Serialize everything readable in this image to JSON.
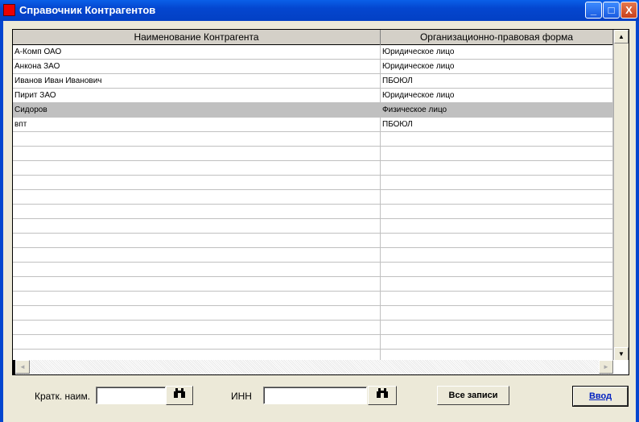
{
  "window": {
    "title": "Справочник Контрагентов",
    "minimize": "_",
    "maximize": "□",
    "close": "X"
  },
  "table": {
    "columns": [
      "Наименование Контрагента",
      "Организационно-правовая форма"
    ],
    "rows": [
      [
        "А-Комп ОАО",
        "Юридическое лицо"
      ],
      [
        "Анкона ЗАО",
        "Юридическое лицо"
      ],
      [
        "Иванов Иван Иванович",
        "ПБОЮЛ"
      ],
      [
        "Пирит ЗАО",
        "Юридическое лицо"
      ],
      [
        "Сидоров",
        "Физическое лицо"
      ],
      [
        "впт",
        "ПБОЮЛ"
      ]
    ],
    "selected_row": 4
  },
  "filters": {
    "short_name_label": "Кратк. наим.",
    "short_name_value": "",
    "inn_label": "ИНН",
    "inn_value": ""
  },
  "buttons": {
    "all_records": "Все записи",
    "enter": "Ввод",
    "search_icon": "binoculars-icon"
  }
}
